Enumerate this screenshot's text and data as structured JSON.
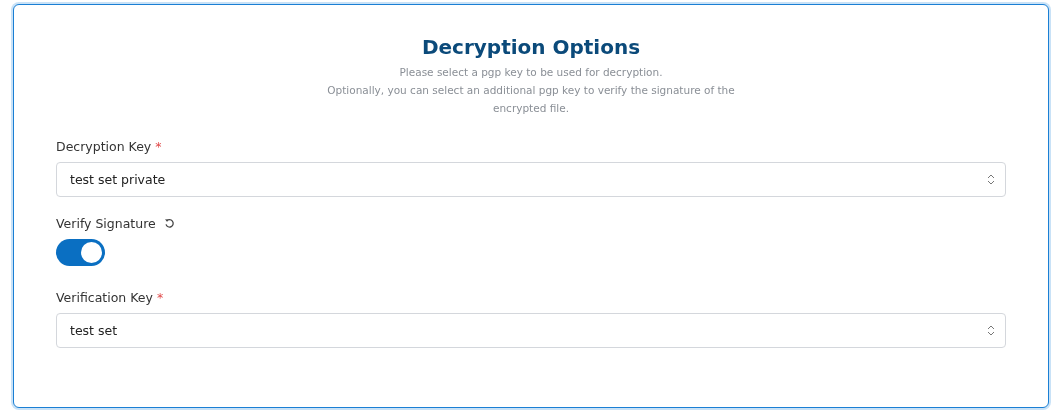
{
  "title": "Decryption Options",
  "description": [
    "Please select a pgp key to be used for decryption.",
    "Optionally, you can select an additional pgp key to verify the signature of the encrypted file."
  ],
  "fields": [
    {
      "kind": "select",
      "label": "Decryption Key",
      "required_mark": "*",
      "value": "test set private"
    },
    {
      "kind": "toggle",
      "label": "Verify Signature",
      "on": true
    },
    {
      "kind": "select",
      "label": "Verification Key",
      "required_mark": "*",
      "value": "test set"
    }
  ]
}
